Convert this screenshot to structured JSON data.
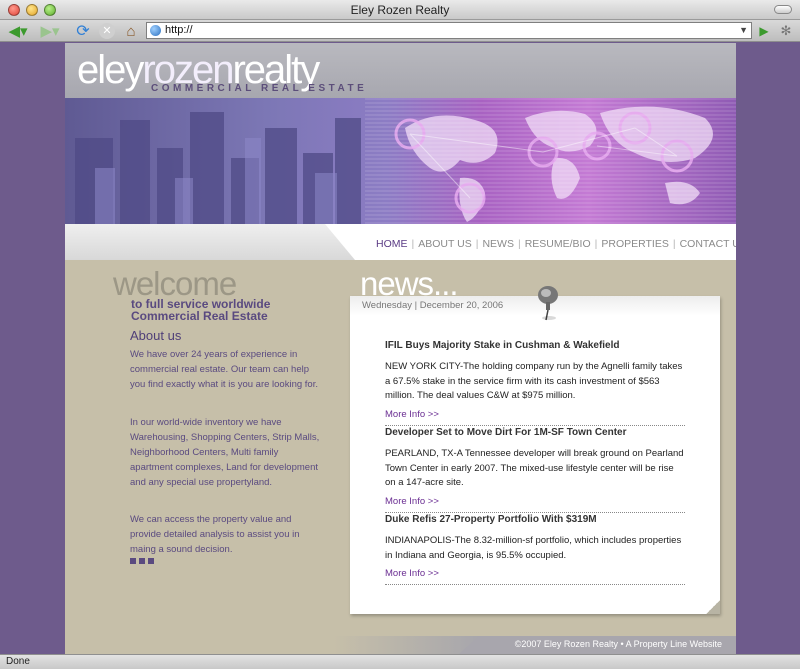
{
  "browser": {
    "window_title": "Eley Rozen Realty",
    "address": "http://",
    "status": "Done"
  },
  "logo": {
    "part1": "eley",
    "part2": "rozen",
    "part3": "realty",
    "subtitle": "COMMERCIAL REAL ESTATE"
  },
  "nav": {
    "items": [
      "HOME",
      "ABOUT US",
      "NEWS",
      "RESUME/BIO",
      "PROPERTIES",
      "CONTACT US"
    ],
    "active": "HOME"
  },
  "welcome": {
    "heading": "welcome",
    "tagline_line1": "to full service worldwide",
    "tagline_line2": "Commercial Real Estate",
    "about_heading": "About us",
    "paragraphs": [
      "We have over 24 years of experience in commercial real estate. Our team can help you find exactly what it is you are looking for.",
      "In our world-wide inventory we have Warehousing, Shopping Centers, Strip Malls, Neighborhood Centers, Multi family apartment complexes, Land for development and any special use propertyland.",
      "We can access the property value and provide detailed analysis to assist you in maing a sound decision."
    ]
  },
  "news": {
    "heading": "news...",
    "date": "Wednesday | December 20, 2006",
    "articles": [
      {
        "title": "IFIL Buys Majority Stake in Cushman & Wakefield",
        "body": "NEW YORK CITY-The holding company run by the Agnelli family takes a 67.5% stake in the service firm with its cash investment of $563 million. The deal values C&W at $975 million.",
        "more": "More Info >>"
      },
      {
        "title": "Developer Set to Move Dirt For 1M-SF Town Center",
        "body": "PEARLAND, TX-A Tennessee developer will break ground on Pearland Town Center in early 2007. The mixed-use lifestyle center will be rise on a 147-acre site.",
        "more": "More Info >>"
      },
      {
        "title": "Duke Refis 27-Property Portfolio With $319M",
        "body": "INDIANAPOLIS-The 8.32-million-sf portfolio, which includes properties in Indiana and Georgia, is 95.5% occupied.",
        "more": "More Info >>"
      }
    ]
  },
  "footer": {
    "text": "©2007 Eley Rozen Realty • A Property Line Website"
  },
  "colors": {
    "brand_purple": "#5a4a80",
    "page_bg": "#c6bfa9",
    "outer_bg": "#6e5b8c",
    "link": "#6b2f93"
  }
}
